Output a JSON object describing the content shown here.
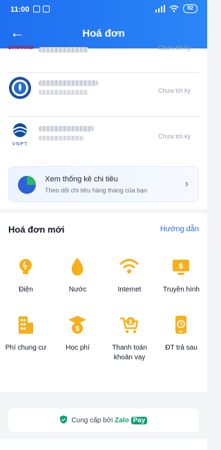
{
  "status_bar": {
    "time": "11:00",
    "battery": "92"
  },
  "header": {
    "title": "Hoá đơn"
  },
  "bills": [
    {
      "logo_text": "EVNHANOI",
      "status": "Chưa tới kỳ"
    },
    {
      "logo_text": "",
      "status": "Chưa tới kỳ"
    },
    {
      "logo_text": "VNPT",
      "status": "Chưa tới kỳ"
    }
  ],
  "stats": {
    "title": "Xem thống kê chi tiêu",
    "subtitle": "Theo dõi chi tiêu hàng tháng của bạn"
  },
  "new_bills": {
    "title": "Hoá đơn mới",
    "guide_label": "Hướng dẫn",
    "items": [
      {
        "label": "Điện",
        "icon": "bulb-icon"
      },
      {
        "label": "Nước",
        "icon": "water-drop-icon"
      },
      {
        "label": "Internet",
        "icon": "wifi-icon"
      },
      {
        "label": "Truyền hình",
        "icon": "tv-icon"
      },
      {
        "label": "Phí chung cư",
        "icon": "building-icon"
      },
      {
        "label": "Học phí",
        "icon": "graduation-cap-icon"
      },
      {
        "label": "Thanh toán khoản vay",
        "icon": "loan-cart-icon"
      },
      {
        "label": "ĐT trả sau",
        "icon": "phone-icon"
      }
    ]
  },
  "footer": {
    "prefix": "Cung cấp bởi",
    "brand_a": "Zalo",
    "brand_b": "Pay"
  },
  "colors": {
    "primary": "#1e6ff0",
    "icon": "#f6b01c",
    "brand": "#0d9e72"
  }
}
